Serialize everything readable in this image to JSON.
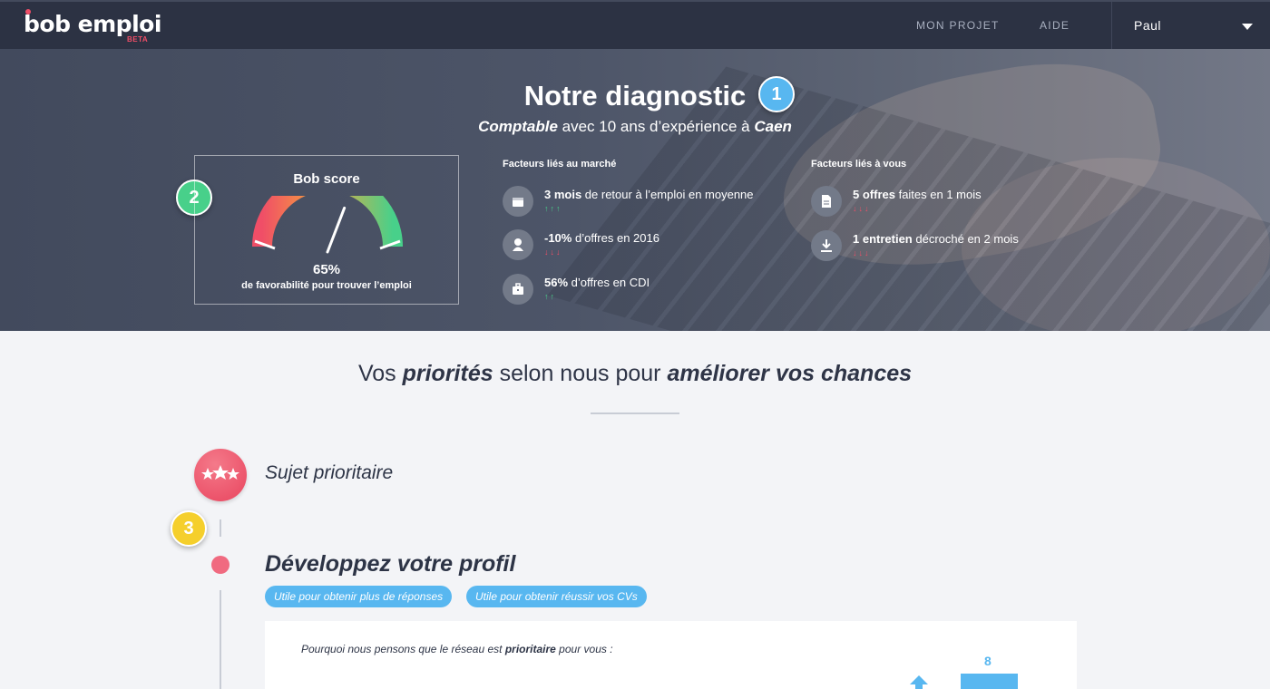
{
  "nav": {
    "logo": "bob emploi",
    "beta": "BETA",
    "links": [
      "MON PROJET",
      "AIDE"
    ],
    "user": "Paul"
  },
  "hero": {
    "title": "Notre diagnostic",
    "subtitle": {
      "job": "Comptable",
      "middle": " avec 10 ans d’expérience à ",
      "city": "Caen"
    },
    "badges": [
      "1",
      "2",
      "3"
    ],
    "score": {
      "title": "Bob score",
      "percent": "65%",
      "caption": "de favorabilité pour trouver l’emploi",
      "value": 0.65
    },
    "market": {
      "title": "Facteurs liés au marché",
      "items": [
        {
          "bold": "3 mois",
          "text": " de retour à l’emploi en moyenne",
          "arrows": "↑↑↑",
          "trend": "up",
          "icon": "calendar-icon"
        },
        {
          "bold": "-10%",
          "text": " d’offres en 2016",
          "arrows": "↓↓↓",
          "trend": "down",
          "icon": "person-icon"
        },
        {
          "bold": "56%",
          "text": " d’offres en CDI",
          "arrows": "↑↑",
          "trend": "up",
          "icon": "briefcase-icon"
        }
      ]
    },
    "personal": {
      "title": "Facteurs liés à vous",
      "items": [
        {
          "bold": "5 offres",
          "text": " faites en 1 mois",
          "arrows": "↓↓↓",
          "trend": "down",
          "icon": "document-icon"
        },
        {
          "bold": "1 entretien",
          "text": " décroché en 2 mois",
          "arrows": "↓↓↓",
          "trend": "down",
          "icon": "download-icon"
        }
      ]
    }
  },
  "main": {
    "priorities": {
      "pre": "Vos ",
      "b1": "priorités",
      "mid": " selon nous pour ",
      "b2": "améliorer vos chances"
    },
    "sujet": "Sujet prioritaire",
    "develop": "Développez votre profil",
    "tags": [
      "Utile pour obtenir plus de réponses",
      "Utile pour obtenir réussir vos CVs"
    ],
    "card": {
      "q_pre": "Pourquoi nous pensons que le réseau est ",
      "q_bold": "prioritaire",
      "q_post": " pour vous :",
      "bar_value": "8"
    }
  },
  "colors": {
    "nav_bg": "#2c3243",
    "accent_red": "#f04e67",
    "accent_blue": "#58b7f0",
    "badge_1": "#58b7f0",
    "badge_2": "#48d08a",
    "badge_3": "#f5cf2c",
    "up": "#48d08a",
    "down": "#f04e67"
  }
}
